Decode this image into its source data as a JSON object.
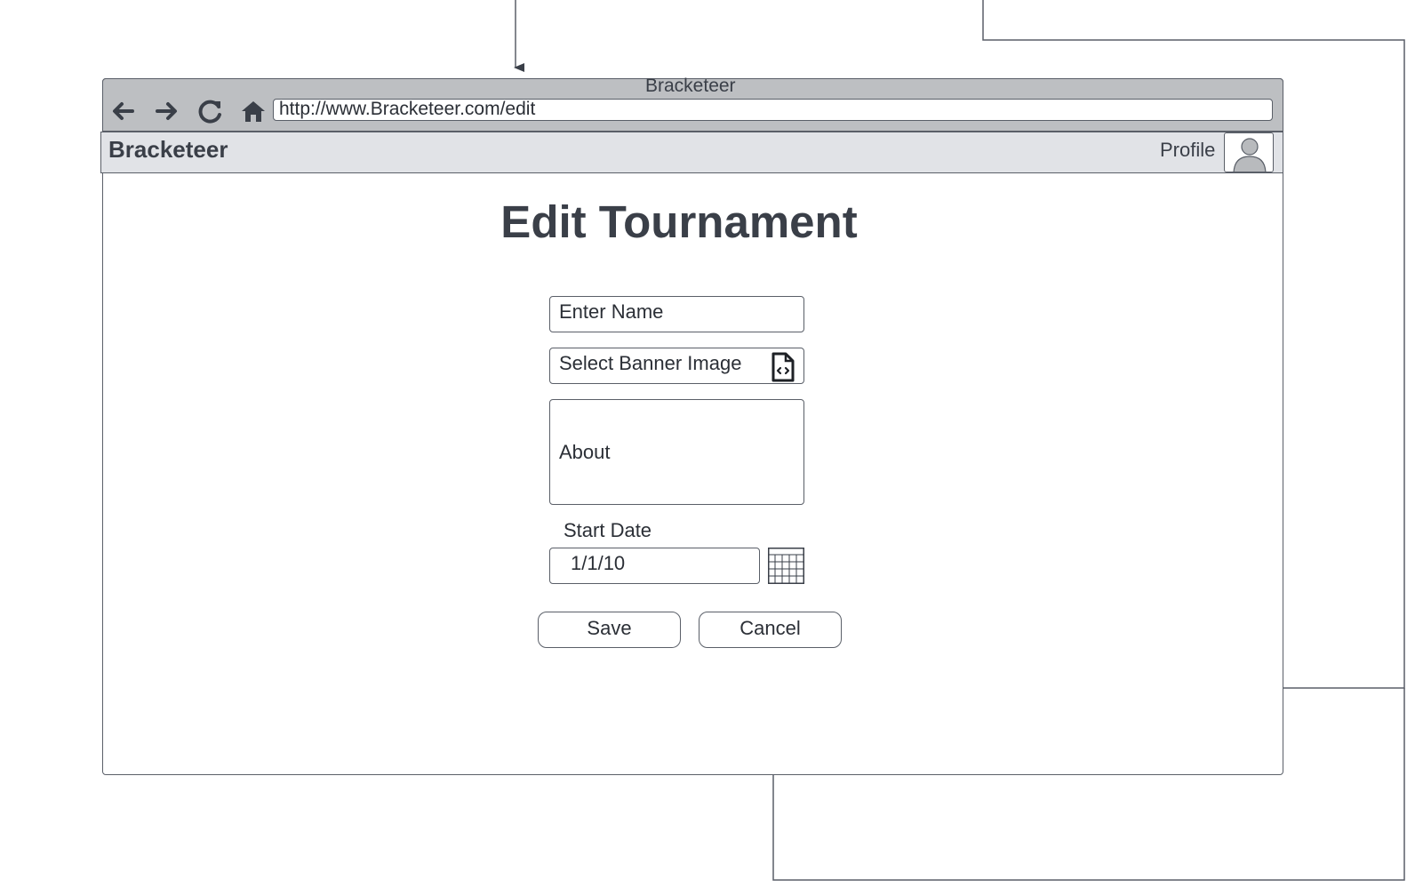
{
  "window": {
    "title": "Bracketeer"
  },
  "browser": {
    "url": "http://www.Bracketeer.com/edit"
  },
  "header": {
    "brand": "Bracketeer",
    "profile_label": "Profile"
  },
  "page": {
    "title": "Edit Tournament"
  },
  "form": {
    "name_placeholder": "Enter Name",
    "banner_label": "Select Banner Image",
    "about_placeholder": "About",
    "start_date_label": "Start Date",
    "start_date_value": "1/1/10"
  },
  "actions": {
    "save_label": "Save",
    "cancel_label": "Cancel"
  },
  "icons": [
    "back-arrow-icon",
    "forward-arrow-icon",
    "reload-icon",
    "home-icon",
    "file-code-icon",
    "calendar-icon",
    "user-avatar-icon"
  ],
  "colors": {
    "stroke": "#5a5f68",
    "chrome": "#bdbfc2",
    "header": "#e1e3e7",
    "text": "#3a3f48"
  }
}
